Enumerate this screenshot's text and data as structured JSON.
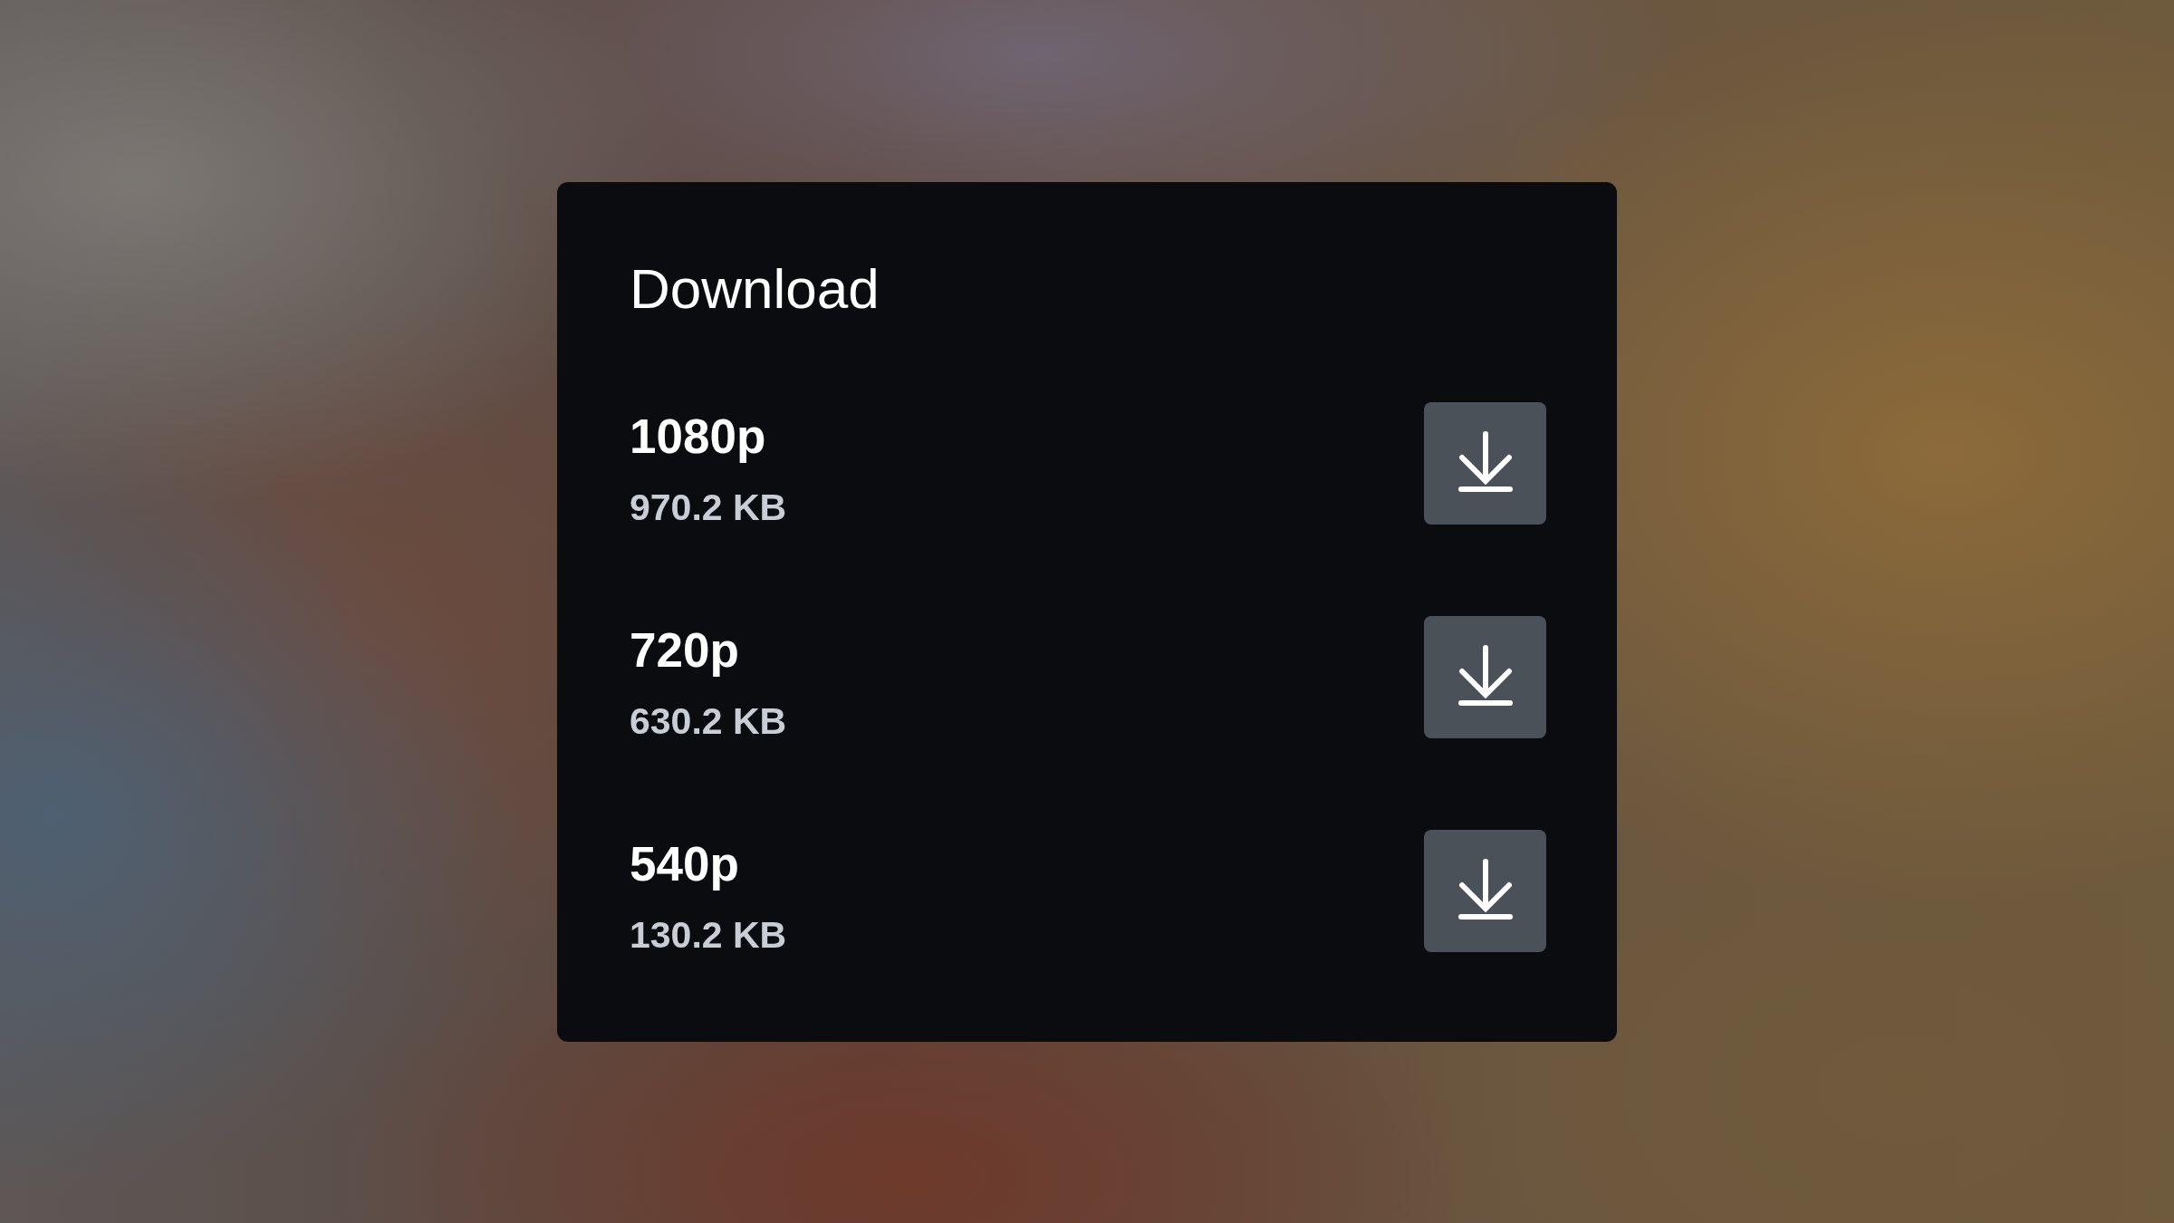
{
  "dialog": {
    "title": "Download",
    "options": [
      {
        "resolution": "1080p",
        "size": "970.2 KB"
      },
      {
        "resolution": "720p",
        "size": "630.2 KB"
      },
      {
        "resolution": "540p",
        "size": "130.2 KB"
      }
    ]
  }
}
